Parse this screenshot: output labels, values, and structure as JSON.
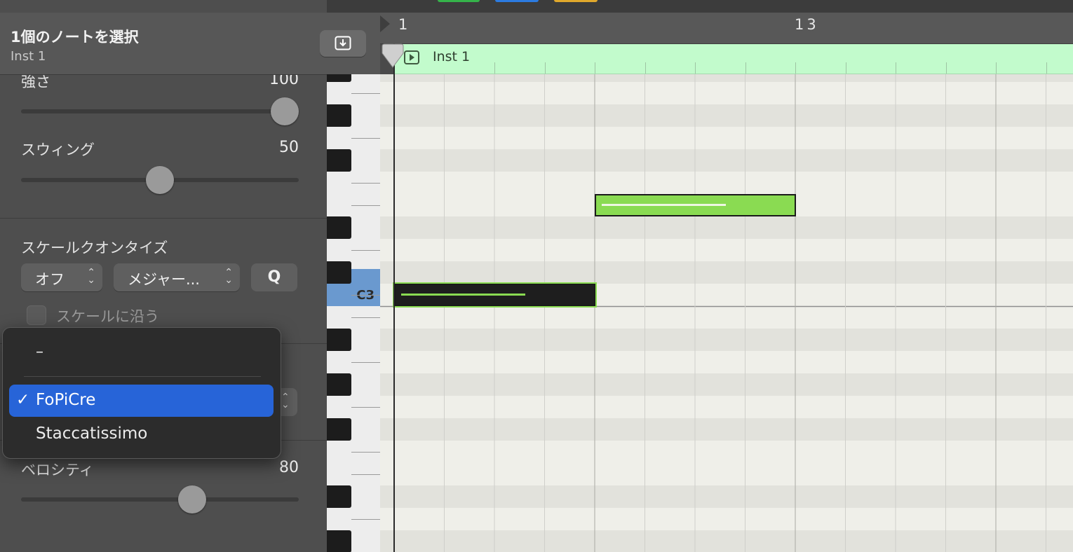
{
  "inspector": {
    "selection_title": "1個のノートを選択",
    "selection_subtitle": "Inst 1",
    "strength": {
      "label": "強さ",
      "value": "100",
      "slider_fraction": 1.0
    },
    "swing": {
      "label": "スウィング",
      "value": "50",
      "slider_fraction": 0.5
    },
    "scale_quantize": {
      "label": "スケールクオンタイズ",
      "mode_value": "オフ",
      "scale_value": "メジャー...",
      "q_label": "Q",
      "follow_label": "スケールに沿う"
    },
    "velocity": {
      "label": "ベロシティ",
      "value": "80",
      "slider_fraction": 0.63
    }
  },
  "dropdown": {
    "items": [
      {
        "label": "–",
        "selected": false
      },
      {
        "label": "FoPiCre",
        "selected": true
      },
      {
        "label": "Staccatissimo",
        "selected": false
      }
    ],
    "check_glyph": "✓"
  },
  "piano": {
    "highlighted_key": "C3"
  },
  "ruler": {
    "markers": [
      "1",
      "13"
    ]
  },
  "region": {
    "name": "Inst 1",
    "color": "#c2fbcc"
  },
  "notes": [
    {
      "pitch": "C3",
      "start_step": 0,
      "length_steps": 4,
      "selected": true
    },
    {
      "pitch": "E3",
      "start_step": 4,
      "length_steps": 4,
      "selected": false
    }
  ],
  "colors": {
    "note_green": "#8adb52",
    "selection_blue": "#2764d8",
    "c3_key_blue": "#6a99cf"
  }
}
